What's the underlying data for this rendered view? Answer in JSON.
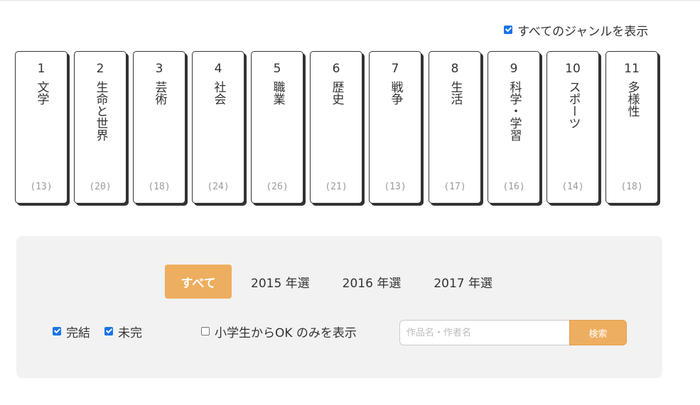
{
  "show_all_genres": {
    "label": "すべてのジャンルを表示",
    "checked": true
  },
  "genres": [
    {
      "number": "1",
      "name": "文学",
      "count": "(13)"
    },
    {
      "number": "2",
      "name": "生命と世界",
      "count": "(20)"
    },
    {
      "number": "3",
      "name": "芸術",
      "count": "(18)"
    },
    {
      "number": "4",
      "name": "社会",
      "count": "(24)"
    },
    {
      "number": "5",
      "name": "職業",
      "count": "(26)"
    },
    {
      "number": "6",
      "name": "歴史",
      "count": "(21)"
    },
    {
      "number": "7",
      "name": "戦争",
      "count": "(13)"
    },
    {
      "number": "8",
      "name": "生活",
      "count": "(17)"
    },
    {
      "number": "9",
      "name": "科学・学習",
      "count": "(16)"
    },
    {
      "number": "10",
      "name": "スポーツ",
      "count": "(14)"
    },
    {
      "number": "11",
      "name": "多様性",
      "count": "(18)"
    }
  ],
  "year_tabs": [
    {
      "label": "すべて",
      "active": true
    },
    {
      "label": "2015 年選",
      "active": false
    },
    {
      "label": "2016 年選",
      "active": false
    },
    {
      "label": "2017 年選",
      "active": false
    }
  ],
  "filters": {
    "completed": {
      "label": "完結",
      "checked": true
    },
    "incomplete": {
      "label": "未完",
      "checked": true
    },
    "elementary_ok": {
      "label": "小学生からOK のみを表示",
      "checked": false
    }
  },
  "search": {
    "placeholder": "作品名・作者名",
    "value": "",
    "button_label": "検索"
  },
  "colors": {
    "accent": "#eeae5f",
    "panel_bg": "#f2f2f2",
    "checkbox": "#1a73e8"
  }
}
